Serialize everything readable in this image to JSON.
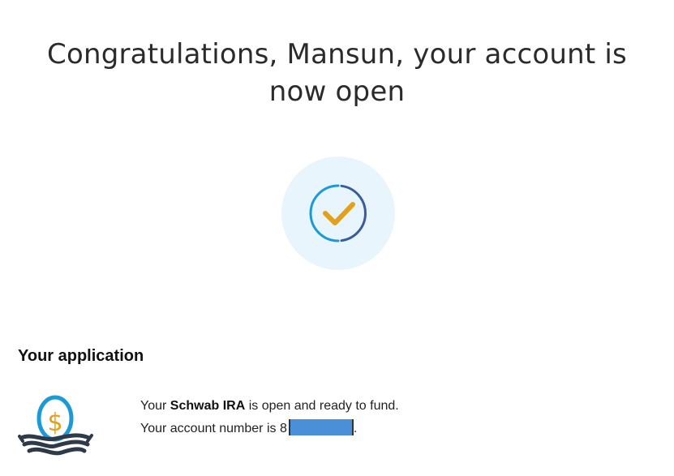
{
  "header": {
    "title": "Congratulations, Mansun, your account is now open"
  },
  "status": {
    "icon": "checkmark-success-icon",
    "colors": {
      "ring": "#1b9ad6",
      "ring_dark": "#3a5d99",
      "check": "#e3a11b",
      "background": "#e8f5fc"
    }
  },
  "application": {
    "heading": "Your application",
    "icon": "nest-egg-dollar-icon",
    "line1_prefix": "Your ",
    "line1_product": "Schwab IRA",
    "line1_suffix": " is open and ready to fund.",
    "line2_prefix": "Your account number is ",
    "line2_number_visible": "8",
    "line2_suffix": "."
  }
}
